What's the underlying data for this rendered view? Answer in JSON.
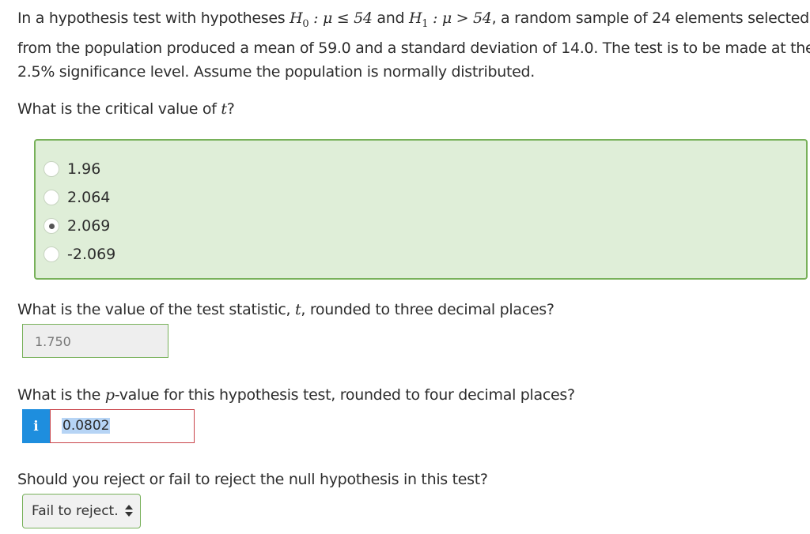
{
  "intro": {
    "seg1": "In a hypothesis test with hypotheses ",
    "h0_symbol": "H",
    "h0_sub": "0",
    "h0_expr": " : μ ≤ 54",
    "seg2": " and ",
    "h1_symbol": "H",
    "h1_sub": "1",
    "h1_expr": " : μ > 54",
    "seg3": ", a random sample of 24 elements selected",
    "line2": "from the population produced a mean of 59.0 and a standard deviation of 14.0. The test is to be made at the",
    "line3": "2.5% significance level. Assume the population is normally distributed."
  },
  "q1": {
    "prefix": "What is the critical value of ",
    "var": "t",
    "suffix": "?",
    "options": [
      "1.96",
      "2.064",
      "2.069",
      "-2.069"
    ],
    "selected_index": 2
  },
  "q2": {
    "prefix": "What is the value of the test statistic, ",
    "var": "t",
    "suffix": ", rounded to three decimal places?",
    "value": "1.750"
  },
  "q3": {
    "prefix": "What is the ",
    "var": "p",
    "suffix": "-value for this hypothesis test, rounded to four decimal places?",
    "info_label": "i",
    "value": "0.0802"
  },
  "q4": {
    "text": "Should you reject or fail to reject the null hypothesis in this test?",
    "selected": "Fail to reject."
  },
  "colors": {
    "correct_bg": "#dfeed8",
    "correct_border": "#78b15a",
    "error_border": "#c9444a",
    "info_blue": "#1e8ede"
  }
}
